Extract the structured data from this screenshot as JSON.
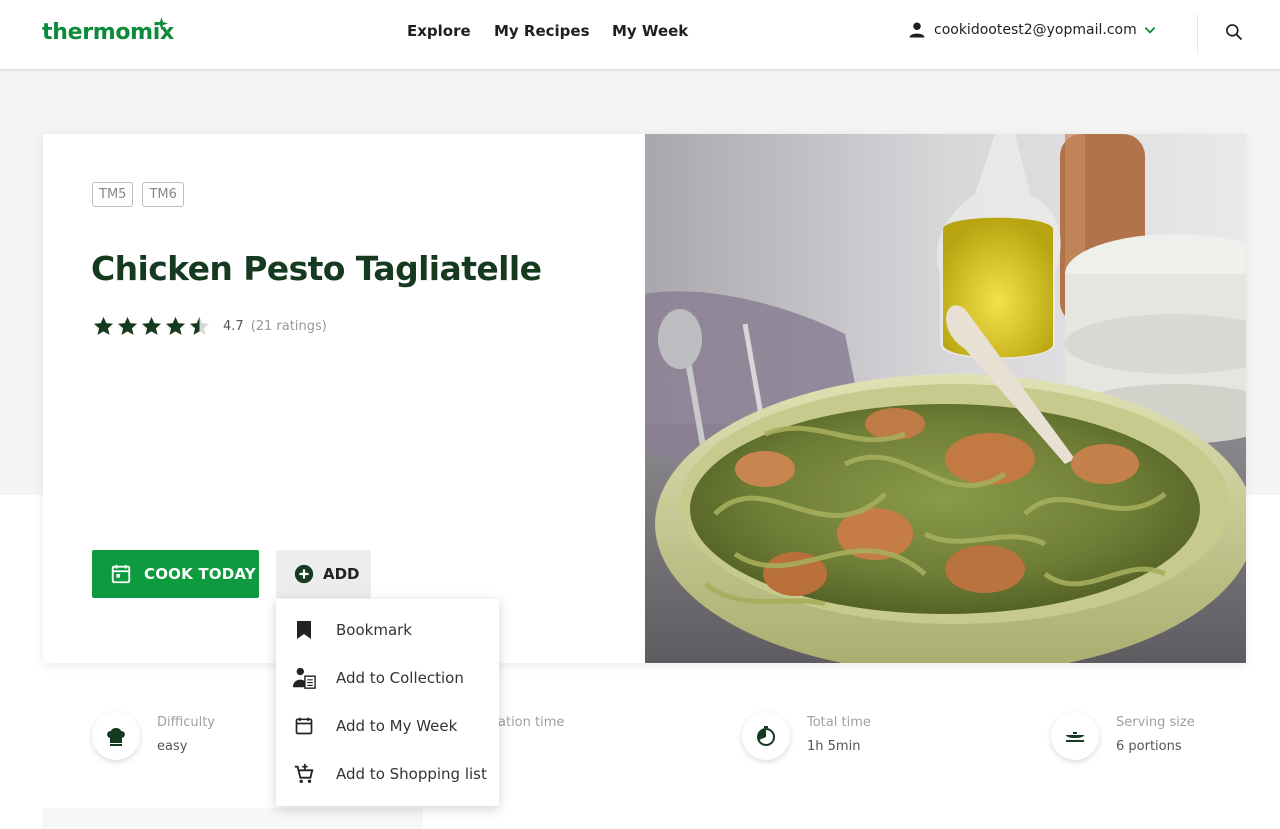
{
  "header": {
    "logo": "thermomix",
    "nav": [
      "Explore",
      "My Recipes",
      "My Week"
    ],
    "user_email": "cookidootest2@yopmail.com"
  },
  "recipe": {
    "tags": [
      "TM5",
      "TM6"
    ],
    "title": "Chicken Pesto Tagliatelle",
    "rating_value": "4.7",
    "rating_count": "(21 ratings)",
    "stars_filled": 4.5,
    "cook_today_label": "COOK TODAY",
    "add_label": "ADD"
  },
  "add_menu": {
    "items": [
      "Bookmark",
      "Add to Collection",
      "Add to My Week",
      "Add to Shopping list"
    ]
  },
  "info": {
    "difficulty": {
      "label": "Difficulty",
      "value": "easy"
    },
    "preparation": {
      "label": "ation time",
      "value": ""
    },
    "total": {
      "label": "Total time",
      "value": "1h 5min"
    },
    "serving": {
      "label": "Serving size",
      "value": "6 portions"
    }
  },
  "colors": {
    "brand_green": "#0b8a3b",
    "button_green": "#0e9a3f",
    "title_green": "#163a20"
  }
}
